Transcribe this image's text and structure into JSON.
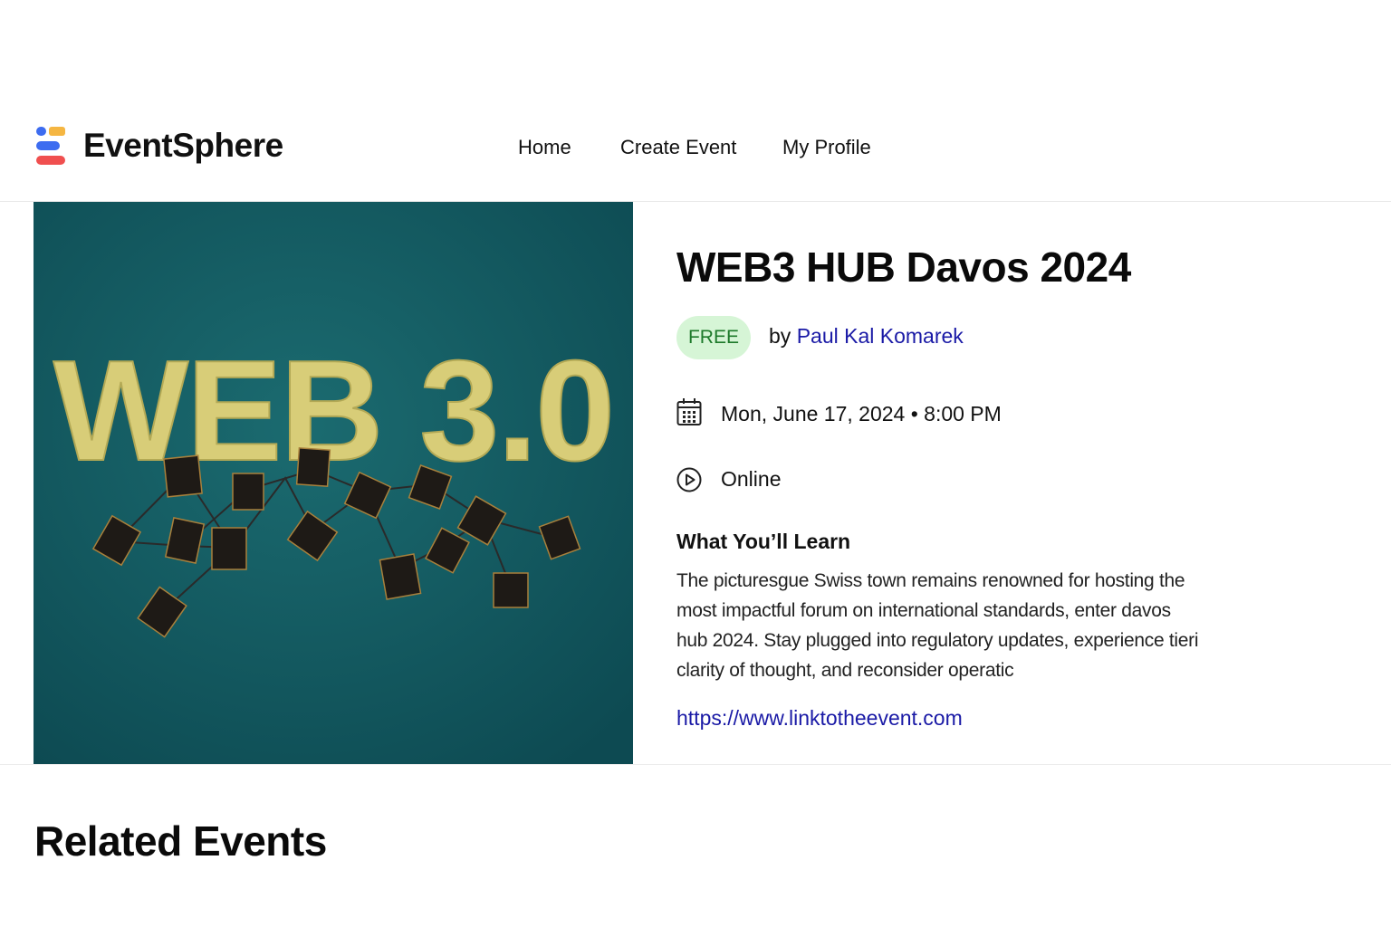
{
  "brand": {
    "name": "EventSphere",
    "logo_icon": "stacked-bars-logo-icon"
  },
  "nav": {
    "items": [
      {
        "label": "Home"
      },
      {
        "label": "Create Event"
      },
      {
        "label": "My Profile"
      }
    ]
  },
  "event": {
    "image_text": "WEB 3.0",
    "title": "WEB3 HUB Davos 2024",
    "price_badge": "FREE",
    "by_prefix": "by",
    "organizer": "Paul Kal Komarek",
    "datetime": "Mon, June 17, 2024 • 8:00 PM",
    "location": "Online",
    "learn_heading": "What You’ll Learn",
    "description": "The picturesgue Swiss town remains renowned for hosting the most impactful forum on international standards, enter davos hub 2024. Stay plugged into regulatory updates, experience tieri clarity of thought, and reconsider operatic",
    "link": "https://www.linktotheevent.com"
  },
  "related": {
    "heading": "Related Events"
  },
  "colors": {
    "badge_bg": "#d6f5d6",
    "badge_text": "#1d7a2a",
    "link": "#1a1aa6",
    "image_bg": "#165a60",
    "image_text": "#d8cd78"
  }
}
